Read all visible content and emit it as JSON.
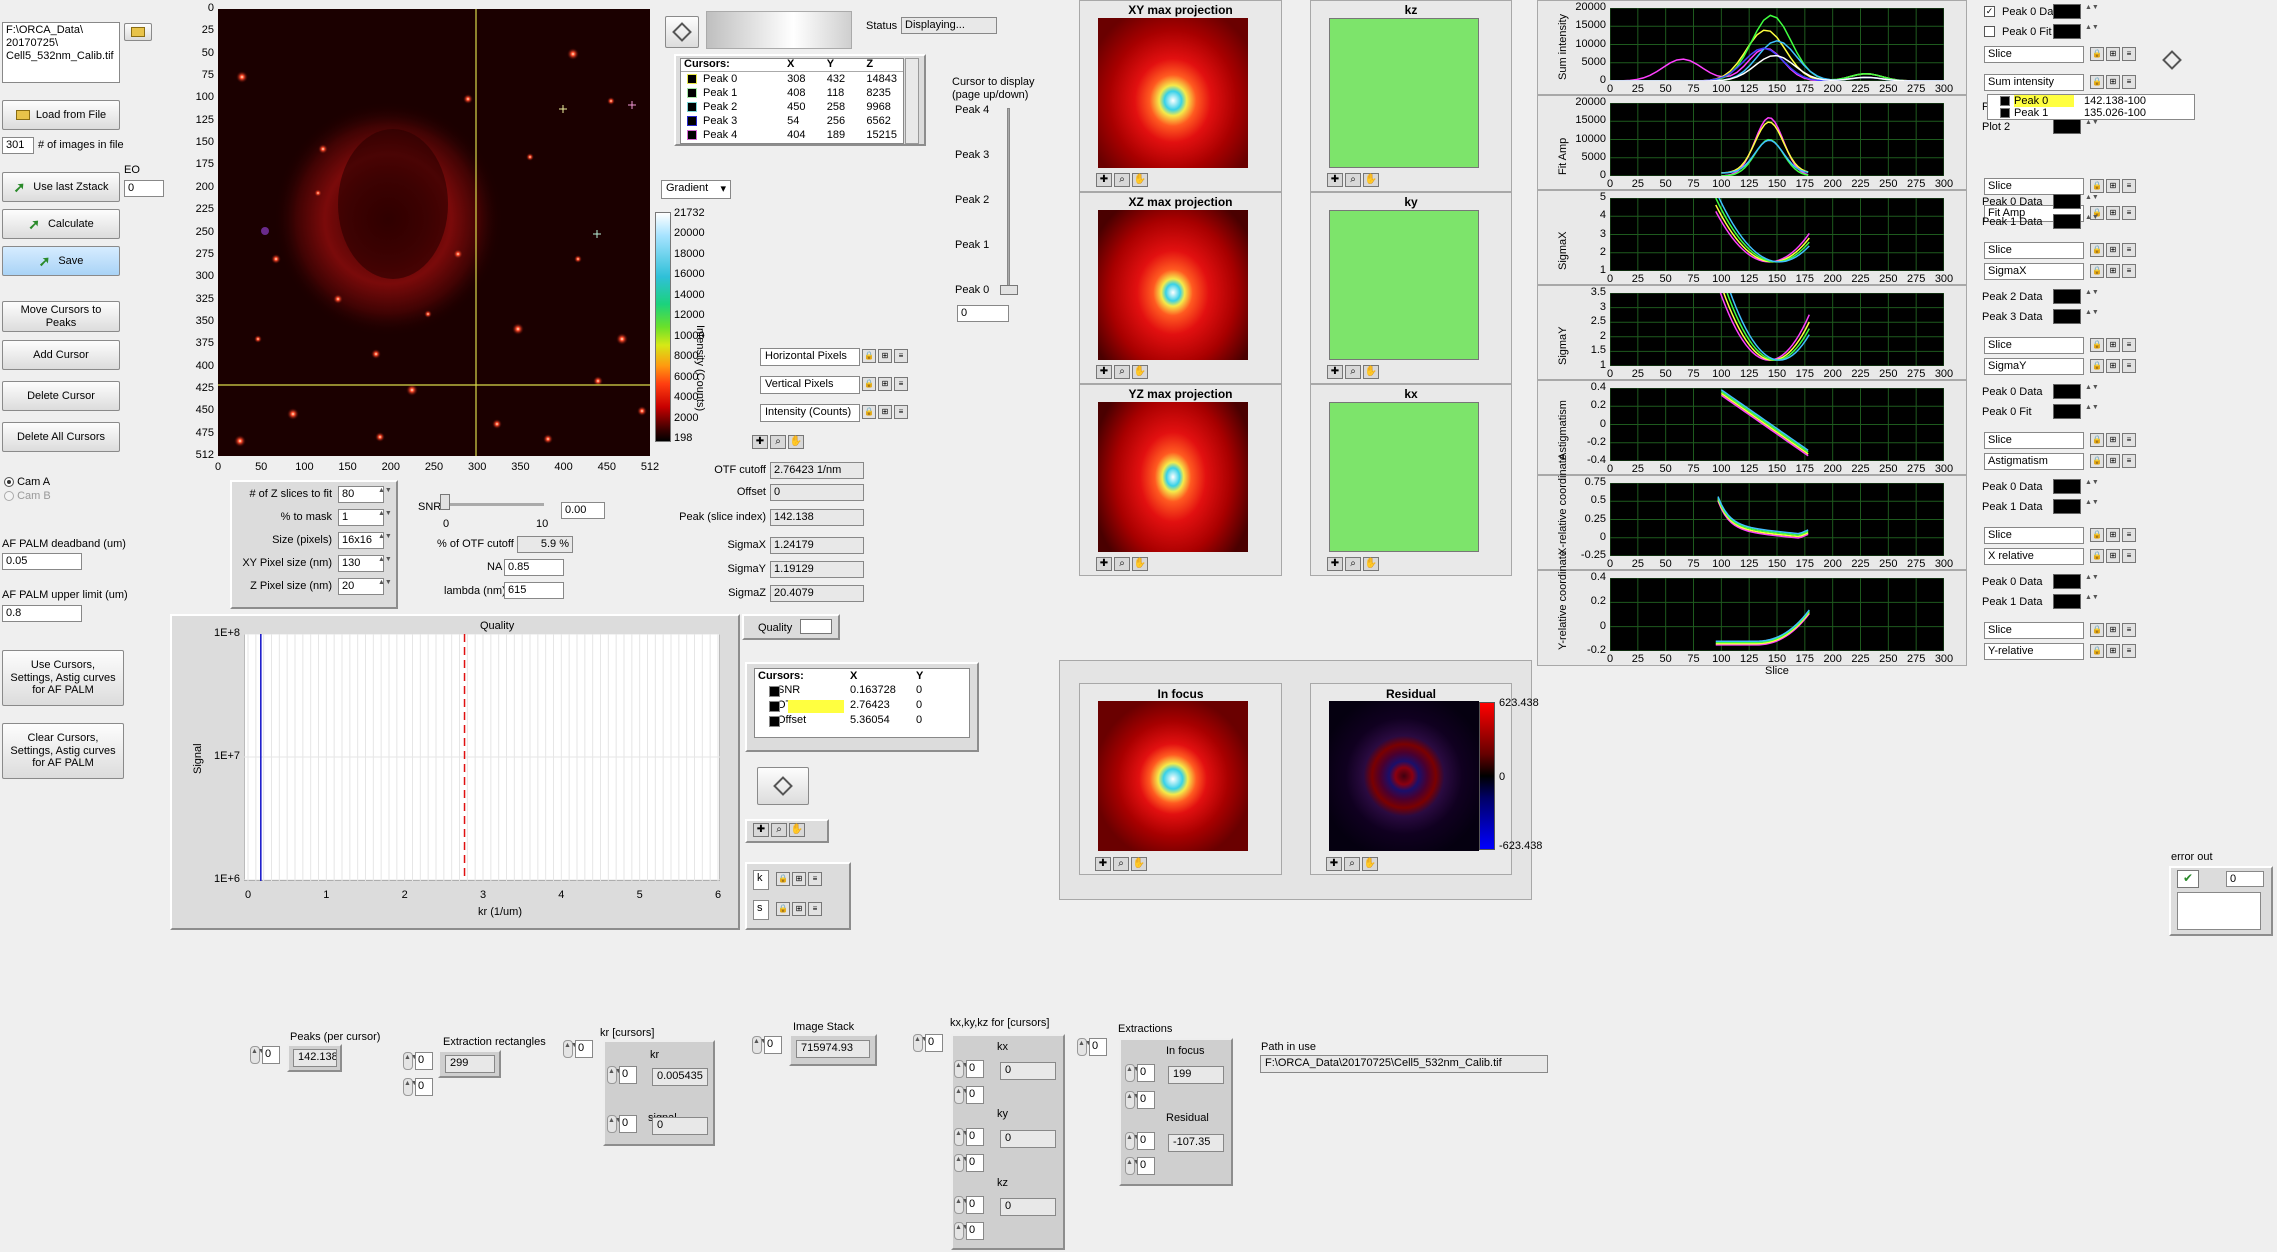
{
  "file_path": "F:\\ORCA_Data\\\n20170725\\\nCell5_532nm_Calib.tif",
  "load_label": "Load from File",
  "num_images": "301",
  "num_images_label": "# of images in file",
  "use_last_label": "Use last Zstack",
  "eo_label": "EO",
  "eo_value": "0",
  "calculate_label": "Calculate",
  "save_label": "Save",
  "move_cursors_label": "Move Cursors to Peaks",
  "add_cursor_label": "Add Cursor",
  "delete_cursor_label": "Delete Cursor",
  "delete_all_label": "Delete All Cursors",
  "cam_a": "Cam A",
  "cam_b": "Cam B",
  "af_deadband_label": "AF PALM deadband (um)",
  "af_deadband": "0.05",
  "af_upper_label": "AF PALM upper limit (um)",
  "af_upper": "0.8",
  "use_cursors_label": "Use Cursors, Settings, Astig curves for AF PALM",
  "clear_cursors_label": "Clear Cursors, Settings, Astig curves for AF PALM",
  "image_y_ticks": [
    "0",
    "25",
    "50",
    "75",
    "100",
    "125",
    "150",
    "175",
    "200",
    "225",
    "250",
    "275",
    "300",
    "325",
    "350",
    "375",
    "400",
    "425",
    "450",
    "475",
    "512"
  ],
  "image_x_ticks": [
    "0",
    "50",
    "100",
    "150",
    "200",
    "250",
    "300",
    "350",
    "400",
    "450",
    "512"
  ],
  "status_label": "Status",
  "status_value": "Displaying...",
  "cursor_table": {
    "headers": [
      "Cursors:",
      "X",
      "Y",
      "Z"
    ],
    "rows": [
      [
        "Peak 0",
        "308",
        "432",
        "14843"
      ],
      [
        "Peak 1",
        "408",
        "118",
        "8235"
      ],
      [
        "Peak 2",
        "450",
        "258",
        "9968"
      ],
      [
        "Peak 3",
        "54",
        "256",
        "6562"
      ],
      [
        "Peak 4",
        "404",
        "189",
        "15215"
      ]
    ]
  },
  "cursor_display_label": "Cursor to display (page up/down)",
  "peak_slider_labels": [
    "Peak 4",
    "Peak 3",
    "Peak 2",
    "Peak 1",
    "Peak 0"
  ],
  "peak_slider_value": "0",
  "gradient_label": "Gradient",
  "colorbar_ticks": [
    "21732",
    "20000",
    "18000",
    "16000",
    "14000",
    "12000",
    "10000",
    "8000",
    "6000",
    "4000",
    "2000",
    "198"
  ],
  "colorbar_axis": "Intensity (Counts)",
  "axis_rows": [
    "Horizontal Pixels",
    "Vertical Pixels",
    "Intensity (Counts)"
  ],
  "settings": {
    "z_slices_label": "# of Z slices to fit",
    "z_slices": "80",
    "mask_label": "% to mask",
    "mask": "1",
    "size_label": "Size (pixels)",
    "size": "16x16",
    "xy_pixel_label": "XY Pixel size (nm)",
    "xy_pixel": "130",
    "z_pixel_label": "Z Pixel size (nm)",
    "z_pixel": "20"
  },
  "snr_label": "SNR",
  "snr_ticks": [
    "0",
    "10"
  ],
  "snr_value": "0.00",
  "otf_pct_label": "% of OTF cutoff",
  "otf_pct": "5.9 %",
  "na_label": "NA",
  "na": "0.85",
  "lambda_label": "lambda (nm)",
  "lambda": "615",
  "otf_cutoff_label": "OTF cutoff",
  "otf_cutoff": "2.76423 1/nm",
  "offset_label": "Offset",
  "offset": "0",
  "peak_slice_label": "Peak (slice index)",
  "peak_slice": "142.138",
  "sigmax_label": "SigmaX",
  "sigmax": "1.24179",
  "sigmay_label": "SigmaY",
  "sigmay": "1.19129",
  "sigmaz_label": "SigmaZ",
  "sigmaz": "20.4079",
  "quality": {
    "title": "Quality",
    "ylabel": "Signal",
    "xlabel": "kr (1/um)",
    "yticks": [
      "1E+8",
      "1E+7",
      "1E+6"
    ],
    "xticks": [
      "0",
      "1",
      "2",
      "3",
      "4",
      "5",
      "6"
    ],
    "legend": "Quality"
  },
  "quality_cursors": {
    "headers": [
      "Cursors:",
      "X",
      "Y"
    ],
    "rows": [
      [
        "SNR",
        "0.163728",
        "0"
      ],
      [
        "OTF cutoff",
        "2.76423",
        "0"
      ],
      [
        "Offset",
        "5.36054",
        "0"
      ]
    ]
  },
  "projections": [
    "XY max projection",
    "XZ max projection",
    "YZ max projection"
  ],
  "k_titles": [
    "kz",
    "ky",
    "kx"
  ],
  "in_focus_title": "In focus",
  "residual_title": "Residual",
  "residual_ticks": [
    "623.438",
    "0",
    "-623.438"
  ],
  "right_charts": [
    {
      "ylabel": "Sum intensity",
      "yticks": [
        "20000",
        "15000",
        "10000",
        "5000",
        "0"
      ],
      "legend": [
        "Peak 0 Data",
        "Peak 0 Fit"
      ],
      "select": "Slice",
      "name": "Sum intensity"
    },
    {
      "ylabel": "Fit Amp",
      "yticks": [
        "20000",
        "15000",
        "10000",
        "5000",
        "0"
      ],
      "legend": [
        "Peak 1 Data",
        "Plot 2"
      ],
      "select": "Slice",
      "name": "Fit Amp"
    },
    {
      "ylabel": "SigmaX",
      "yticks": [
        "5",
        "4",
        "3",
        "2",
        "1"
      ],
      "legend": [
        "Peak 0 Data",
        "Peak 1 Data"
      ],
      "select": "Slice",
      "name": "SigmaX"
    },
    {
      "ylabel": "SigmaY",
      "yticks": [
        "3.5",
        "3",
        "2.5",
        "2",
        "1.5",
        "1"
      ],
      "legend": [
        "Peak 2 Data",
        "Peak 3 Data"
      ],
      "select": "Slice",
      "name": "SigmaY"
    },
    {
      "ylabel": "Astigmatism",
      "yticks": [
        "0.4",
        "0.2",
        "0",
        "-0.2",
        "-0.4"
      ],
      "legend": [
        "Peak 0 Data",
        "Peak 0 Fit"
      ],
      "select": "Slice",
      "name": "Astigmatism"
    },
    {
      "ylabel": "X-relative coordinate",
      "yticks": [
        "0.75",
        "0.5",
        "0.25",
        "0",
        "-0.25"
      ],
      "legend": [
        "Peak 0 Data",
        "Peak 1 Data"
      ],
      "select": "Slice",
      "name": "X relative"
    },
    {
      "ylabel": "Y-relative coordinate",
      "yticks": [
        "0.4",
        "0.2",
        "0",
        "-0.2"
      ],
      "legend": [
        "Peak 0 Data",
        "Peak 1 Data"
      ],
      "select": "Slice",
      "name": "Y-relative"
    }
  ],
  "slice_ticks": [
    "0",
    "25",
    "50",
    "75",
    "100",
    "125",
    "150",
    "175",
    "200",
    "225",
    "250",
    "275",
    "300"
  ],
  "slice_label": "Slice",
  "sum_legend_list": [
    "Peak 0",
    "Peak 1"
  ],
  "sum_legend_vals": [
    "142.138",
    "135.026"
  ],
  "sum_legend_vals2": [
    "-100",
    "-100"
  ],
  "error_out_label": "error out",
  "error_out_value": "0",
  "bottom": {
    "peaks_label": "Peaks (per cursor)",
    "peaks_index": "0",
    "peaks_value": "142.138",
    "extraction_label": "Extraction rectangles",
    "extraction_index": "0",
    "extraction_value": "299",
    "extraction_index2": "0",
    "kr_label": "kr [cursors]",
    "kr_index": "0",
    "kr_sub": "kr",
    "kr_sub_index": "0",
    "kr_value": "0.005435",
    "signal_sub": "signal",
    "signal_index": "0",
    "signal_value": "0",
    "image_stack_label": "Image Stack",
    "image_stack_index": "0",
    "image_stack_value": "715974.93",
    "kxyz_label": "kx,ky,kz for [cursors]",
    "kxyz_index": "0",
    "kx": "kx",
    "ky": "ky",
    "kz": "kz",
    "zero": "0",
    "extractions_label": "Extractions",
    "extractions_index": "0",
    "in_focus": "In focus",
    "in_focus_value": "199",
    "residual": "Residual",
    "residual_value": "-107.35",
    "path_label": "Path in use",
    "path_value": "F:\\ORCA_Data\\20170725\\Cell5_532nm_Calib.tif"
  }
}
